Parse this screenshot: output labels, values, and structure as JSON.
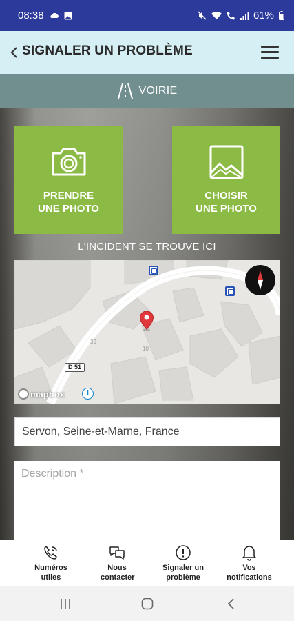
{
  "status_bar": {
    "time": "08:38",
    "battery": "61%"
  },
  "header": {
    "title": "SIGNALER UN PROBLÈME"
  },
  "category": {
    "label": "VOIRIE",
    "icon": "road-icon"
  },
  "actions": {
    "take_photo": "PRENDRE UNE PHOTO",
    "choose_photo": "CHOISIR UNE PHOTO"
  },
  "incident_label": "L'INCIDENT SE TROUVE ICI",
  "map": {
    "road_label": "D 51",
    "attribution": "mapbox",
    "house_numbers": [
      "39",
      "10"
    ]
  },
  "form": {
    "address_value": "Servon, Seine-et-Marne, France",
    "description_placeholder": "Description *"
  },
  "bottom_nav": {
    "items": [
      {
        "label": "Numéros utiles",
        "icon": "phone-icon"
      },
      {
        "label": "Nous contacter",
        "icon": "chat-icon"
      },
      {
        "label": "Signaler un problème",
        "icon": "alert-icon"
      },
      {
        "label": "Vos notifications",
        "icon": "bell-icon"
      }
    ]
  },
  "colors": {
    "status_bar": "#2c3a9c",
    "header": "#d5eff4",
    "category_bar": "#718f8f",
    "action_green": "#8bbb44",
    "pin_red": "#e0383c"
  }
}
